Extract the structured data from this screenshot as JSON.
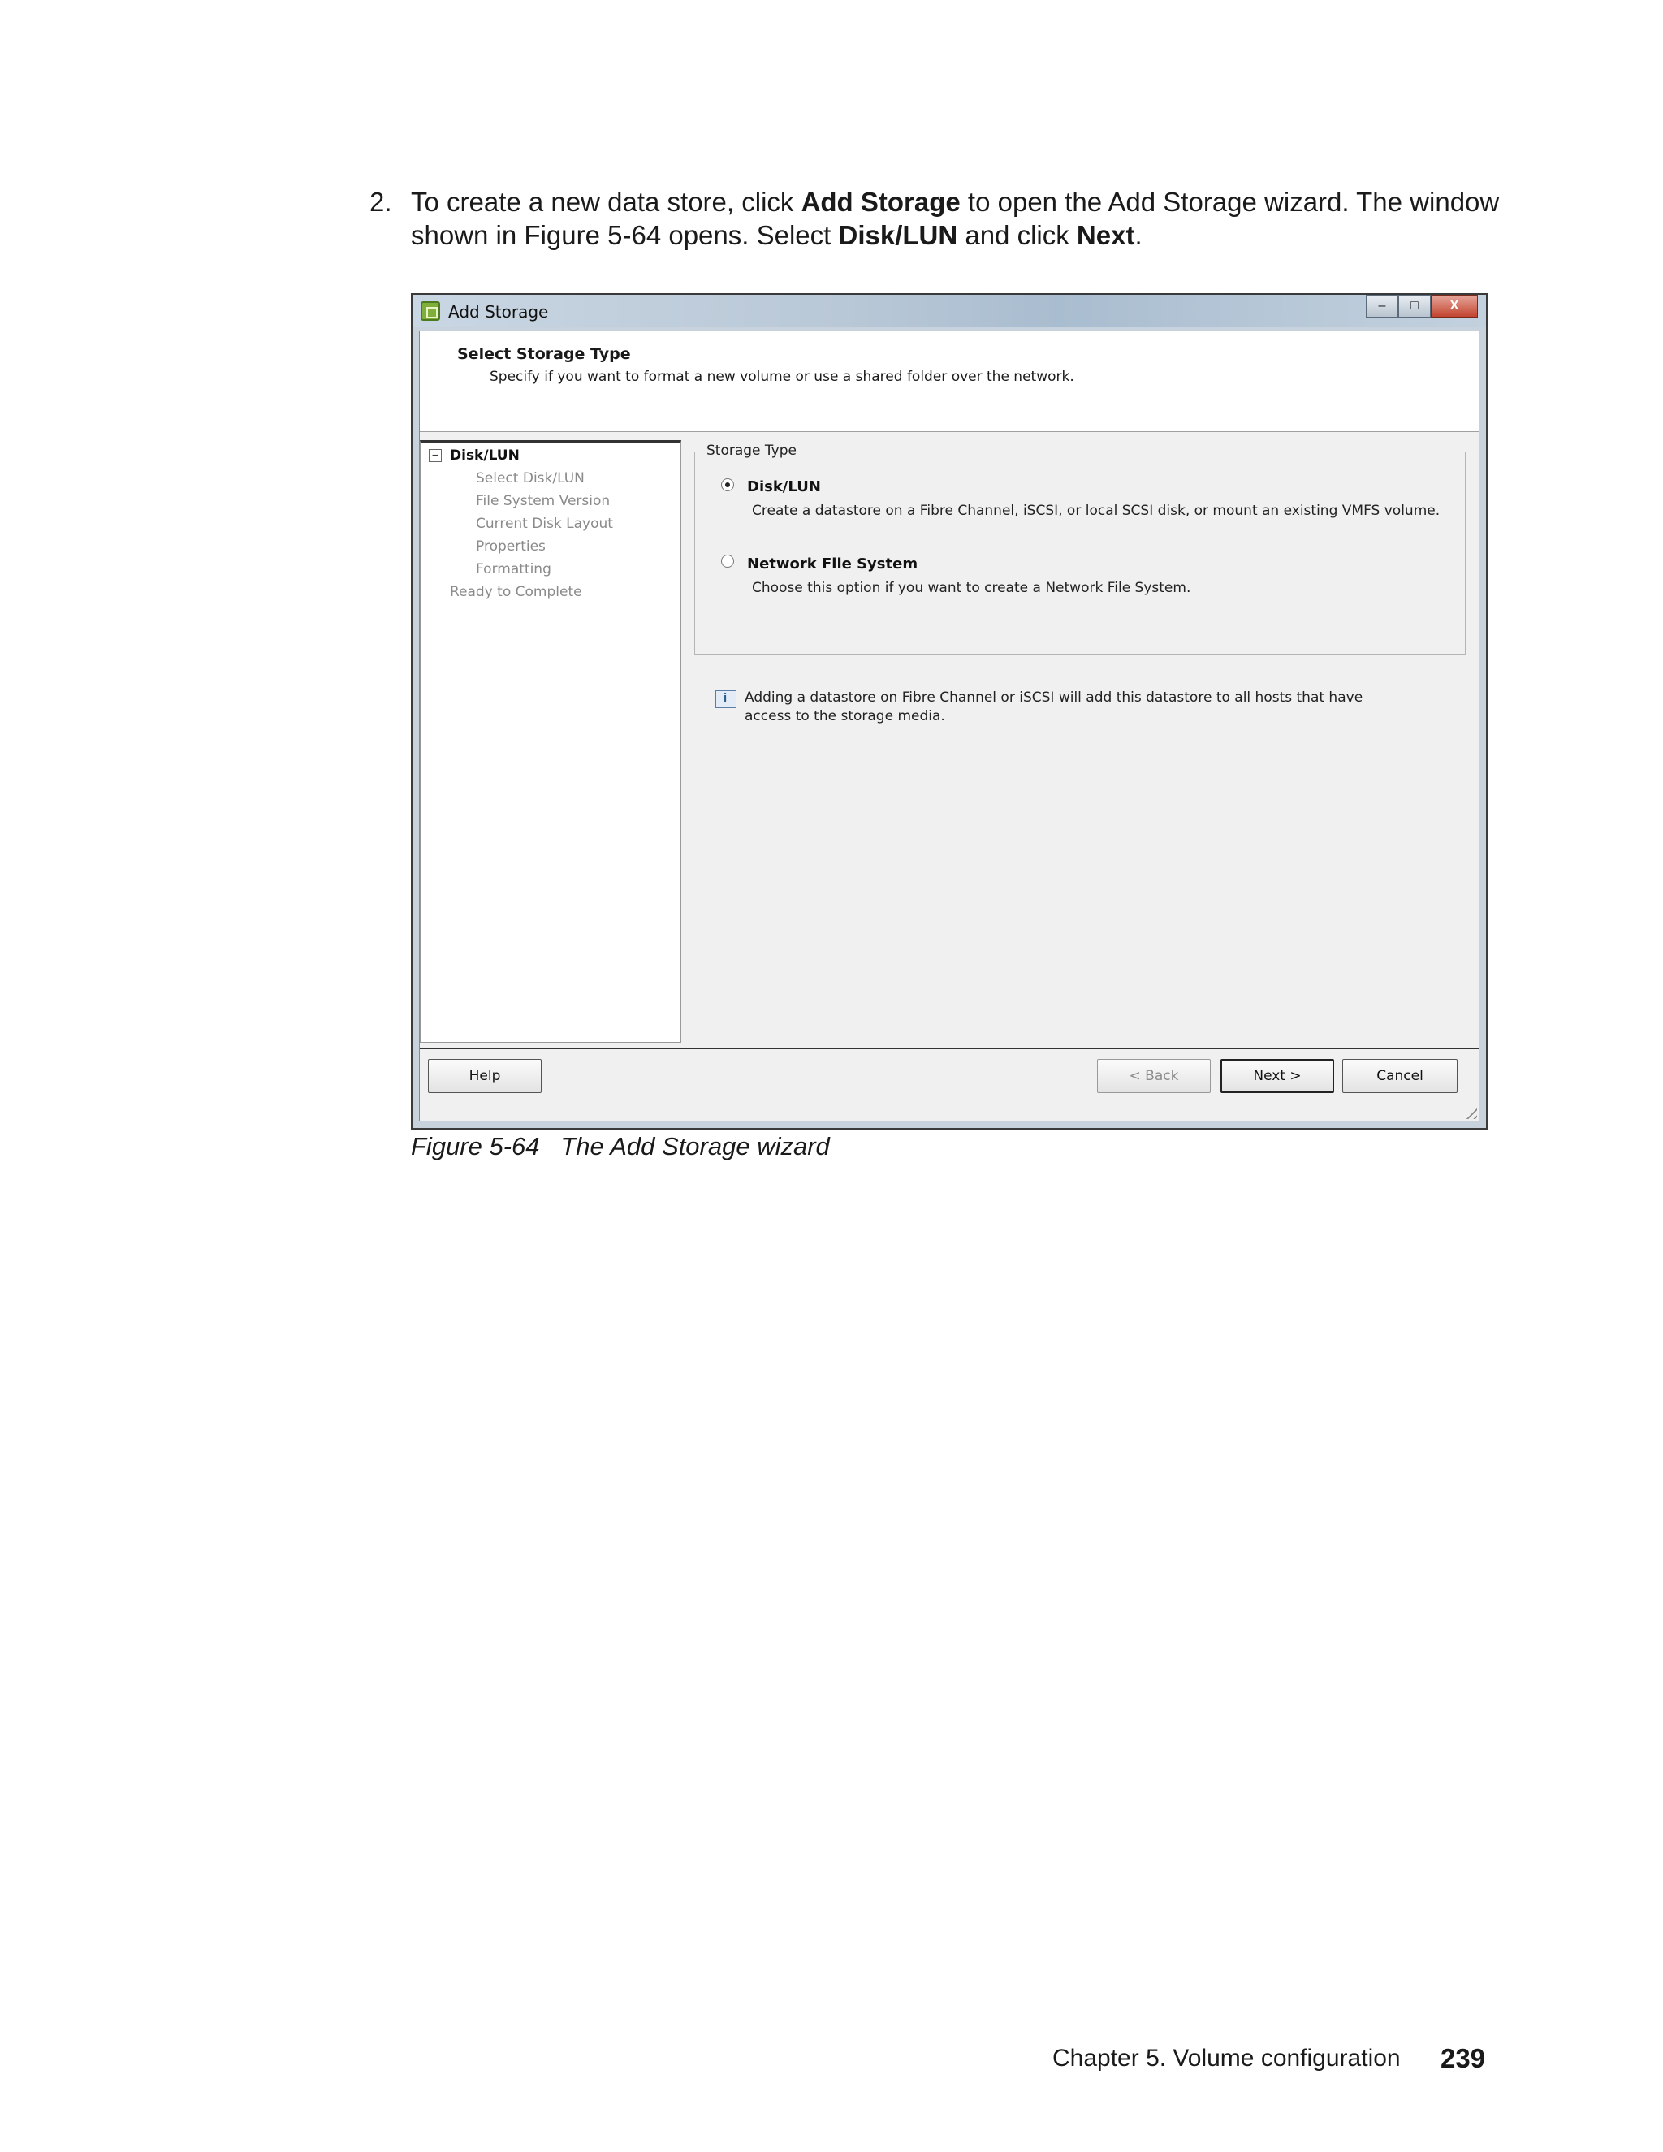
{
  "step": {
    "number": "2.",
    "t1": "To create a new data store, click ",
    "b1": "Add Storage",
    "t2": " to open the Add Storage wizard. The window shown in Figure 5-64 opens. Select ",
    "b2": "Disk/LUN",
    "t3": " and click ",
    "b3": "Next",
    "t4": "."
  },
  "window": {
    "title": "Add Storage",
    "header_title": "Select Storage Type",
    "header_subtitle": "Specify if you want to format a new volume or use a shared folder over the network.",
    "controls": {
      "minimize": "–",
      "maximize": "□",
      "close": "X"
    }
  },
  "nav": {
    "toggle": "−",
    "root": "Disk/LUN",
    "items": [
      "Select Disk/LUN",
      "File System Version",
      "Current Disk Layout",
      "Properties",
      "Formatting",
      "Ready to Complete"
    ]
  },
  "storage_type": {
    "legend": "Storage Type",
    "options": [
      {
        "label": "Disk/LUN",
        "desc": "Create a datastore on a Fibre Channel, iSCSI, or local SCSI disk, or mount an existing VMFS volume.",
        "selected": true
      },
      {
        "label": "Network File System",
        "desc": "Choose this option if you want to create a Network File System.",
        "selected": false
      }
    ]
  },
  "info": "Adding a datastore on Fibre Channel or iSCSI will add this datastore to all hosts that have access to the storage media.",
  "buttons": {
    "help": "Help",
    "back": "< Back",
    "next": "Next >",
    "cancel": "Cancel"
  },
  "caption": "Figure 5-64   The Add Storage wizard",
  "footer": {
    "chapter": "Chapter 5. Volume configuration",
    "page": "239"
  }
}
